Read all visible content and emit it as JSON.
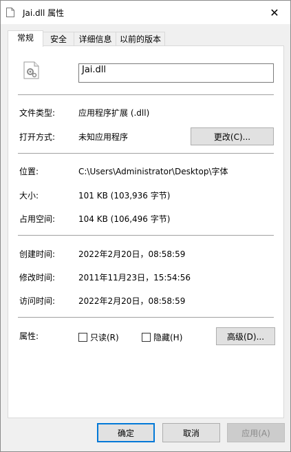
{
  "window": {
    "title": "Jai.dll 属性",
    "close_glyph": "✕"
  },
  "tabs": [
    {
      "label": "常规",
      "active": true
    },
    {
      "label": "安全",
      "active": false
    },
    {
      "label": "详细信息",
      "active": false
    },
    {
      "label": "以前的版本",
      "active": false
    }
  ],
  "general": {
    "file_name": "Jai.dll",
    "file_type_label": "文件类型:",
    "file_type_value": "应用程序扩展 (.dll)",
    "open_with_label": "打开方式:",
    "open_with_value": "未知应用程序",
    "change_button": "更改(C)...",
    "location_label": "位置:",
    "location_value": "C:\\Users\\Administrator\\Desktop\\字体",
    "size_label": "大小:",
    "size_value": "101 KB (103,936 字节)",
    "size_on_disk_label": "占用空间:",
    "size_on_disk_value": "104 KB (106,496 字节)",
    "created_label": "创建时间:",
    "created_value": "2022年2月20日，08:58:59",
    "modified_label": "修改时间:",
    "modified_value": "2011年11月23日，15:54:56",
    "accessed_label": "访问时间:",
    "accessed_value": "2022年2月20日，08:58:59",
    "attributes_label": "属性:",
    "readonly_label": "只读(R)",
    "hidden_label": "隐藏(H)",
    "advanced_button": "高级(D)..."
  },
  "footer": {
    "ok": "确定",
    "cancel": "取消",
    "apply": "应用(A)"
  },
  "colors": {
    "accent": "#0078d7",
    "panel_bg": "#ffffff",
    "window_bg": "#f0f0f0"
  }
}
